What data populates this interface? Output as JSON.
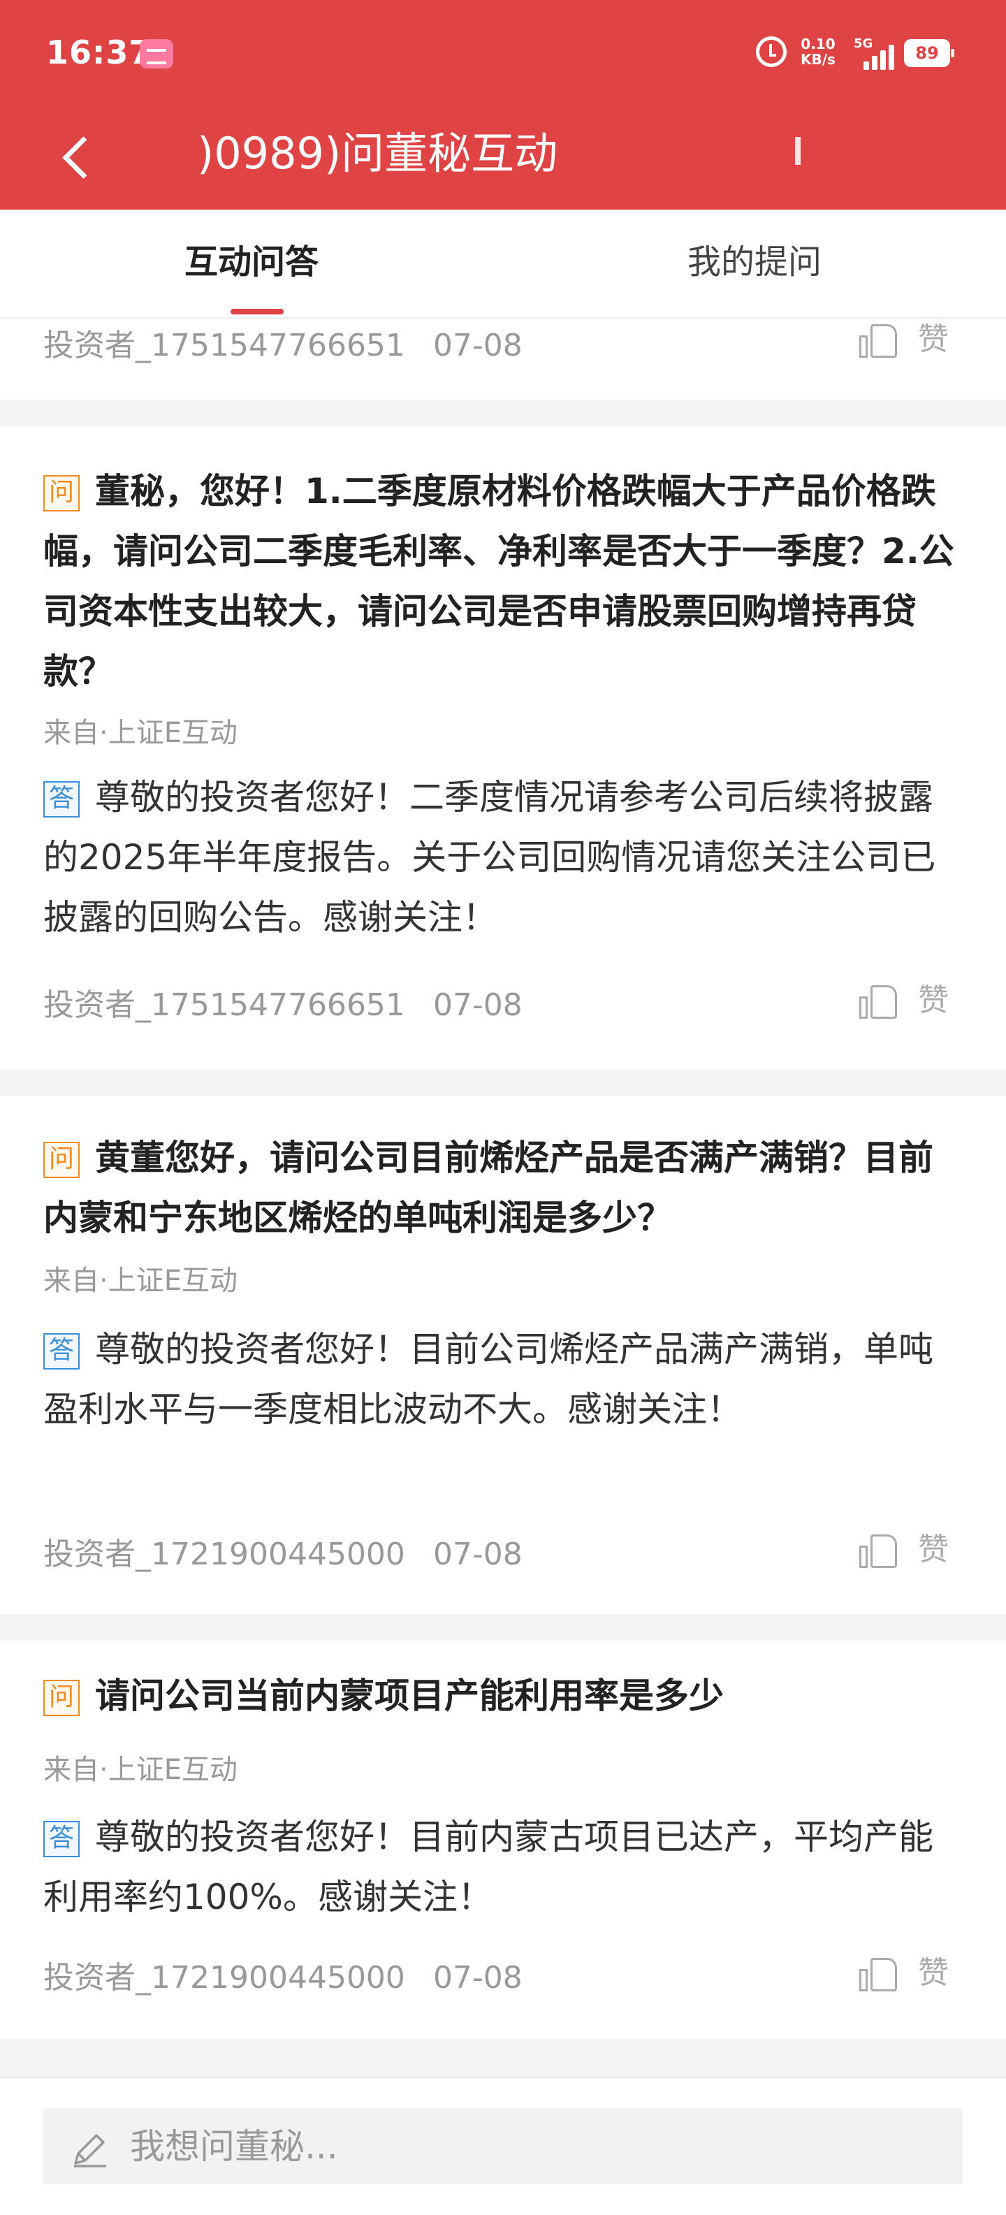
{
  "status_bar": {
    "time": "16:37",
    "net_speed_value": "0.10",
    "net_speed_unit": "KB/s",
    "network_type": "5G",
    "battery": "89"
  },
  "header": {
    "title": ")0989)问董秘互动"
  },
  "tabs": [
    {
      "label": "互动问答",
      "active": true
    },
    {
      "label": "我的提问",
      "active": false
    }
  ],
  "like_label": "赞",
  "tag_question": "问",
  "tag_answer": "答",
  "top_partial": {
    "user": "投资者_1751547766651",
    "date": "07-08"
  },
  "qa_items": [
    {
      "question": "董秘，您好！1.二季度原材料价格跌幅大于产品价格跌幅，请问公司二季度毛利率、净利率是否大于一季度？2.公司资本性支出较大，请问公司是否申请股票回购增持再贷款？",
      "source": "来自·上证E互动",
      "answer": "尊敬的投资者您好！二季度情况请参考公司后续将披露的2025年半年度报告。关于公司回购情况请您关注公司已披露的回购公告。感谢关注！",
      "user": "投资者_1751547766651",
      "date": "07-08"
    },
    {
      "question": "黄董您好，请问公司目前烯烃产品是否满产满销？目前内蒙和宁东地区烯烃的单吨利润是多少？",
      "source": "来自·上证E互动",
      "answer": "尊敬的投资者您好！目前公司烯烃产品满产满销，单吨盈利水平与一季度相比波动不大。感谢关注！",
      "user": "投资者_1721900445000",
      "date": "07-08"
    },
    {
      "question": "请问公司当前内蒙项目产能利用率是多少",
      "source": "来自·上证E互动",
      "answer": "尊敬的投资者您好！目前内蒙古项目已达产，平均产能利用率约100%。感谢关注！",
      "user": "投资者_1721900445000",
      "date": "07-08"
    }
  ],
  "bottom": {
    "placeholder": "我想问董秘..."
  },
  "colors": {
    "brand_red": "#e04343",
    "question_tag": "#f08a24",
    "answer_tag": "#3b8fd9"
  }
}
